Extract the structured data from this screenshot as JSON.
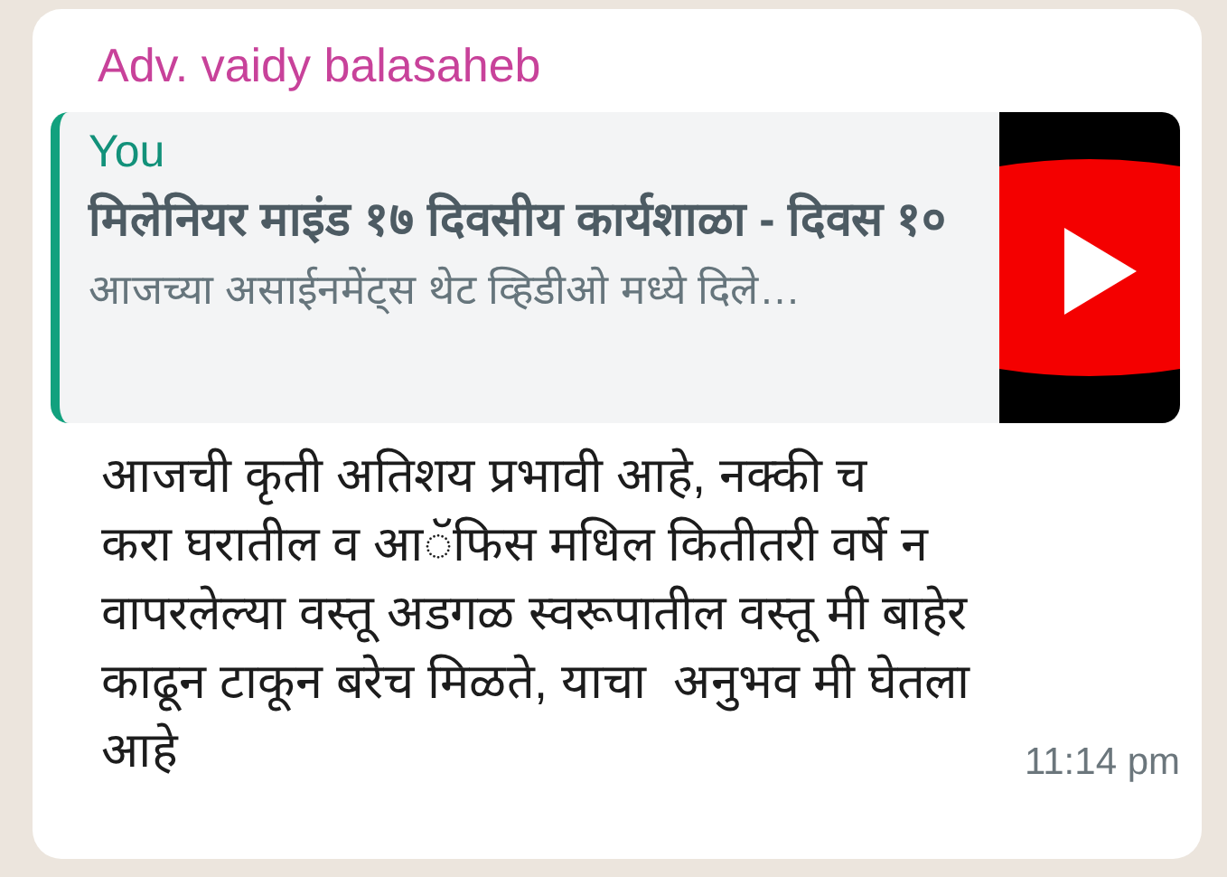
{
  "message": {
    "sender": "Adv. vaidy balasaheb",
    "quote": {
      "author": "You",
      "title": "मिलेनियर माइंड १७ दिवसीय कार्यशाळा - दिवस १०",
      "snippet": "आजच्या असाईनमेंट्स थेट व्हिडीओ मध्ये दिले…"
    },
    "body": "आजची कृती अतिशय प्रभावी आहे, नक्की च\nकरा घरातील व आॅफिस मधिल कितीतरी वर्षे न\nवापरलेल्या वस्तू अडगळ स्वरूपातील वस्तू मी बाहेर\nकाढून टाकून बरेच मिळते, याचा  अनुभव मी घेतला\nआहे",
    "time": "11:14 pm"
  }
}
